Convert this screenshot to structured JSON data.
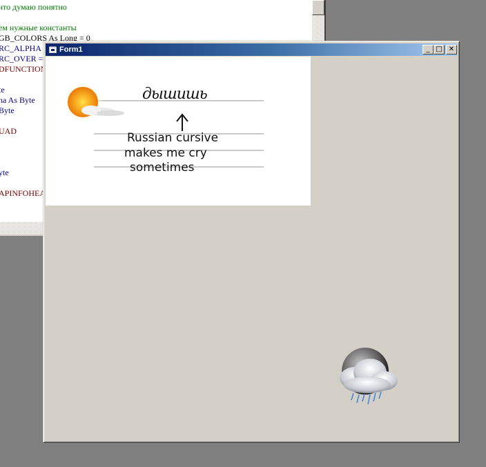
{
  "code_editor": {
    "lines": [
      {
        "text": "что думаю понятно",
        "color": "green"
      },
      {
        "text": "",
        "color": "black"
      },
      {
        "text": "ем нужные константы",
        "color": "green"
      },
      {
        "text": "GB_COLORS As Long = 0",
        "color": "black"
      },
      {
        "text": "RC_ALPHA As",
        "color": "navy"
      },
      {
        "text": "RC_OVER =",
        "color": "navy"
      },
      {
        "text": "DFUNCTION",
        "color": "maroon"
      },
      {
        "text": "",
        "color": "black"
      },
      {
        "text": "te",
        "color": "navy"
      },
      {
        "text": "ha As Byte",
        "color": "navy"
      },
      {
        "text": "Byte",
        "color": "navy"
      },
      {
        "text": "",
        "color": "black"
      },
      {
        "text": "UAD",
        "color": "maroon"
      },
      {
        "text": "",
        "color": "black"
      },
      {
        "text": "",
        "color": "black"
      },
      {
        "text": "",
        "color": "black"
      },
      {
        "text": "yte",
        "color": "navy"
      },
      {
        "text": "",
        "color": "black"
      },
      {
        "text": "APINFOHEA",
        "color": "maroon"
      }
    ]
  },
  "form": {
    "title": "Form1",
    "minimize_glyph": "_",
    "maximize_glyph": "□",
    "close_glyph": "✕",
    "picture": {
      "cursive_word": "дышишь",
      "caption_lines": [
        "Russian cursive",
        "makes me cry",
        "sometimes"
      ]
    }
  },
  "icons": {
    "sun": "sun-cloud-icon",
    "storm": "moon-storm-cloud-icon",
    "title": "form-window-icon"
  }
}
